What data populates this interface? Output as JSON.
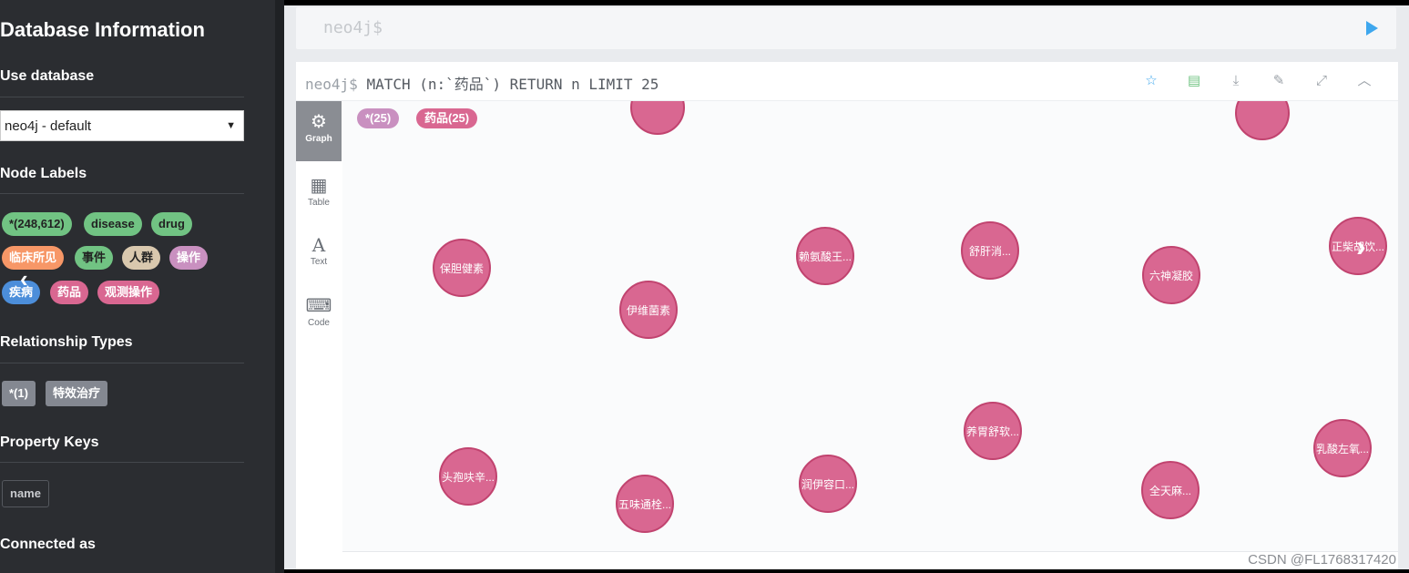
{
  "sidebar": {
    "title": "Database Information",
    "use_database": "Use database",
    "selected_db": "neo4j - default",
    "node_labels_heading": "Node Labels",
    "node_labels": [
      {
        "label": "*(248,612)",
        "color": "#71c383"
      },
      {
        "label": "disease",
        "color": "#71c383"
      },
      {
        "label": "drug",
        "color": "#71c383"
      },
      {
        "label": "临床所见",
        "color": "#f79767"
      },
      {
        "label": "事件",
        "color": "#71c383"
      },
      {
        "label": "人群",
        "color": "#d9c8ae"
      },
      {
        "label": "操作",
        "color": "#c990c0"
      },
      {
        "label": "疾病",
        "color": "#4c8eda"
      },
      {
        "label": "药品",
        "color": "#d96791"
      },
      {
        "label": "观测操作",
        "color": "#d96791"
      }
    ],
    "relationship_types_heading": "Relationship Types",
    "relationship_types": [
      "*(1)",
      "特效治疗"
    ],
    "property_keys_heading": "Property Keys",
    "property_keys": [
      "name"
    ],
    "connected_as_heading": "Connected as"
  },
  "editor": {
    "prompt": "neo4j$"
  },
  "frame": {
    "prompt": "neo4j$",
    "query": "MATCH (n:`药品`) RETURN n LIMIT 25",
    "toolbar_icons": [
      "star-icon",
      "save-icon",
      "download-icon",
      "pin-icon",
      "expand-icon",
      "collapse-icon"
    ],
    "tabs": [
      {
        "label": "Graph",
        "icon": "graph-icon"
      },
      {
        "label": "Table",
        "icon": "table-icon"
      },
      {
        "label": "Text",
        "icon": "text-icon"
      },
      {
        "label": "Code",
        "icon": "code-icon"
      }
    ],
    "result_chips": [
      {
        "label": "*(25)",
        "color": "#c990c0"
      },
      {
        "label": "药品(25)",
        "color": "#d96791"
      }
    ],
    "nodes": [
      {
        "label": "保胆健素"
      },
      {
        "label": "伊维菌素"
      },
      {
        "label": "赖氨酸王..."
      },
      {
        "label": "舒肝消..."
      },
      {
        "label": "六神凝胶"
      },
      {
        "label": "正柴胡饮..."
      },
      {
        "label": "养胃舒软..."
      },
      {
        "label": "乳酸左氧..."
      },
      {
        "label": "头孢呋辛..."
      },
      {
        "label": "五味通栓..."
      },
      {
        "label": "润伊容口..."
      },
      {
        "label": "全天麻..."
      },
      {
        "label": ""
      },
      {
        "label": ""
      }
    ]
  },
  "watermark": "CSDN @FL1768317420"
}
